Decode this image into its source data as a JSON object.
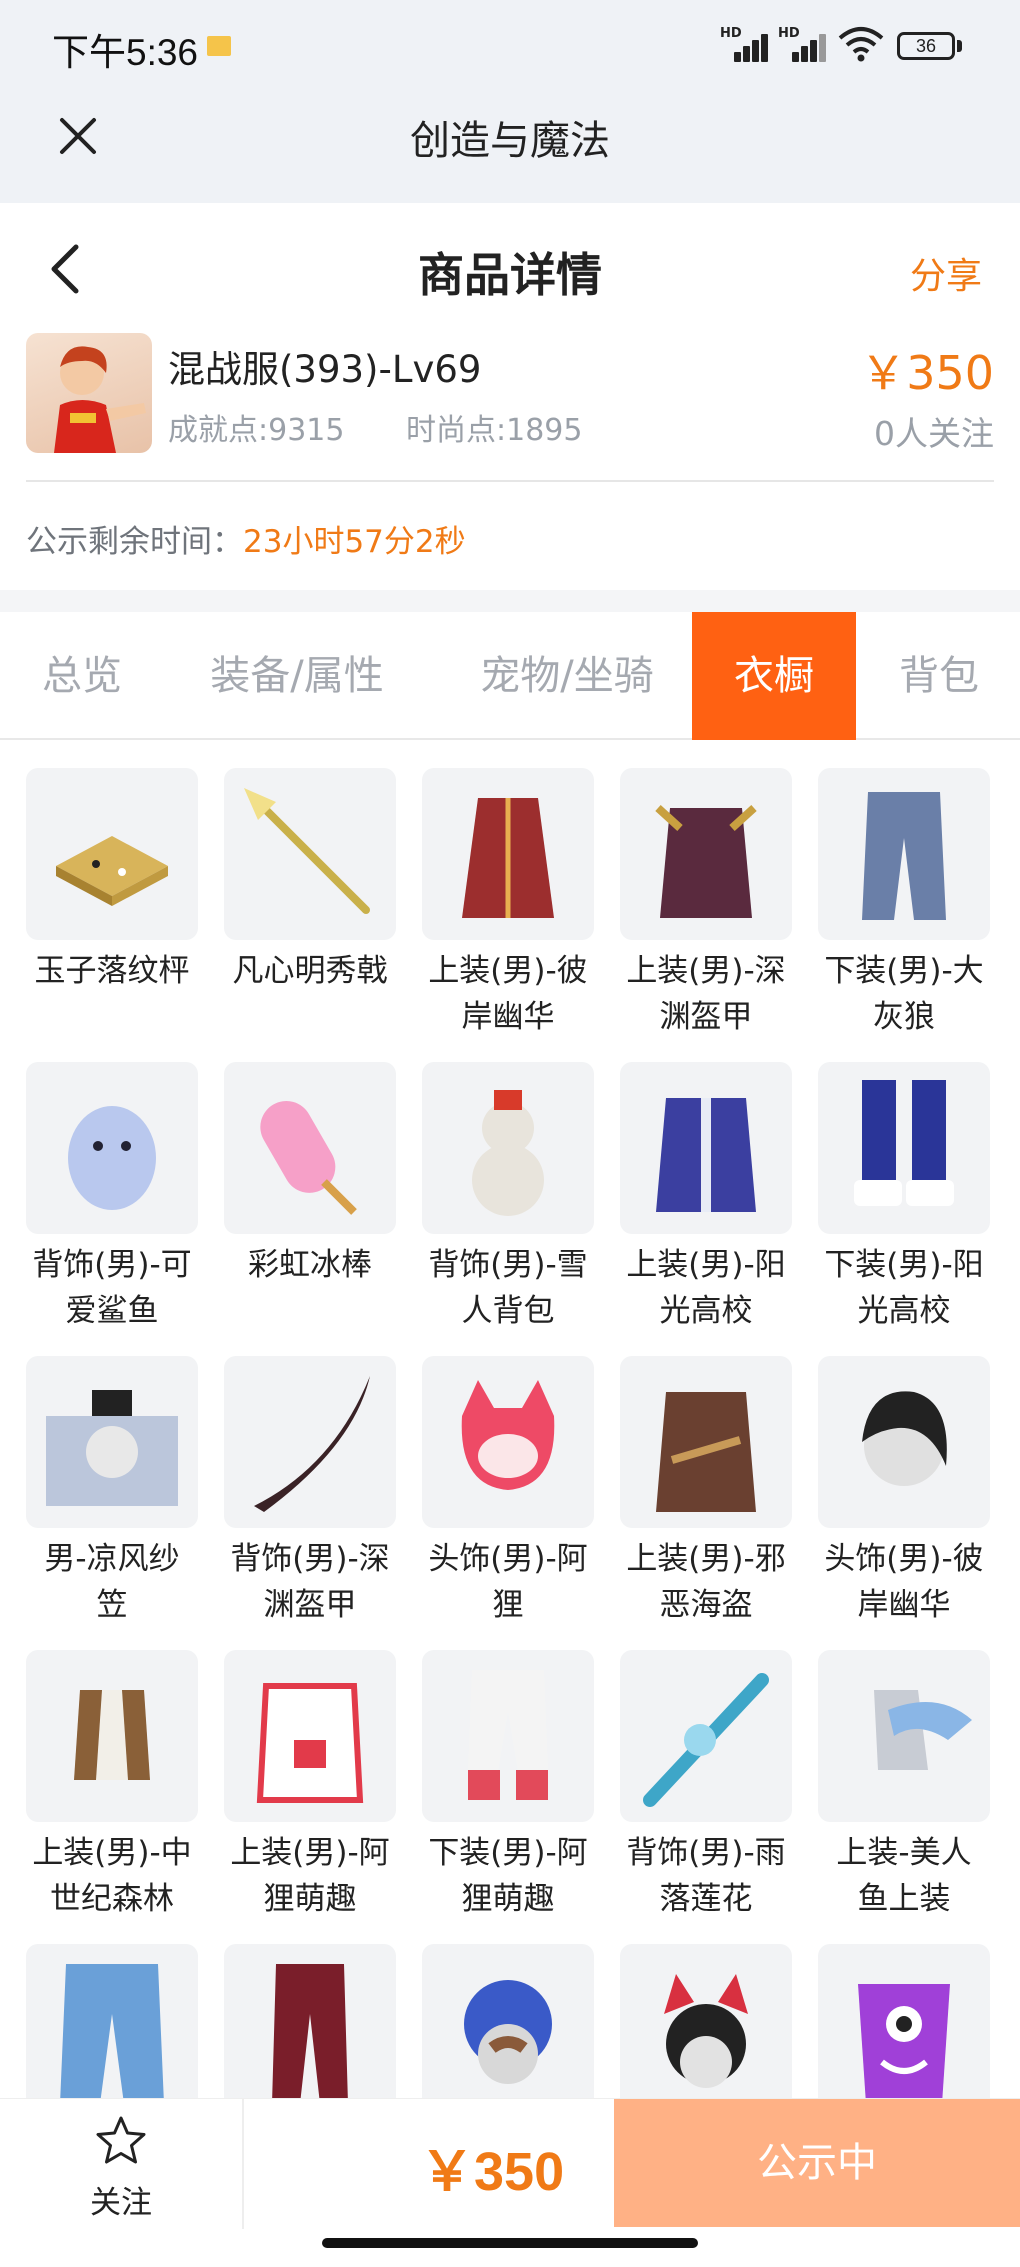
{
  "status_bar": {
    "time": "下午5:36",
    "hd_label": "HD",
    "battery": "36"
  },
  "webview": {
    "title": "创造与魔法"
  },
  "header": {
    "title": "商品详情",
    "share": "分享"
  },
  "product": {
    "name": "混战服(393)-Lv69",
    "achievement": "成就点:9315",
    "fashion": "时尚点:1895",
    "price": "￥350",
    "followers": "0人关注"
  },
  "countdown": {
    "label": "公示剩余时间：",
    "value": "23小时57分2秒"
  },
  "tabs": [
    {
      "label": "总览"
    },
    {
      "label": "装备/属性"
    },
    {
      "label": "宠物/坐骑"
    },
    {
      "label": "衣橱",
      "active": true
    },
    {
      "label": "背包"
    }
  ],
  "wardrobe": [
    {
      "label_1": "玉子落纹枰",
      "label_2": "",
      "icon": "go-board-icon",
      "color": "#d8b45a"
    },
    {
      "label_1": "凡心明秀戟",
      "label_2": "",
      "icon": "halberd-icon",
      "color": "#c9b04a"
    },
    {
      "label_1": "上装(男)-彼",
      "label_2": "岸幽华",
      "icon": "robe-icon",
      "color": "#9c2e2e"
    },
    {
      "label_1": "上装(男)-深",
      "label_2": "渊盔甲",
      "icon": "armor-icon",
      "color": "#5a2a3e"
    },
    {
      "label_1": "下装(男)-大",
      "label_2": "灰狼",
      "icon": "pants-icon",
      "color": "#6a7fa8"
    },
    {
      "label_1": "背饰(男)-可",
      "label_2": "爱鲨鱼",
      "icon": "shark-icon",
      "color": "#b9c8ee"
    },
    {
      "label_1": "彩虹冰棒",
      "label_2": "",
      "icon": "popsicle-icon",
      "color": "#f6a0c8"
    },
    {
      "label_1": "背饰(男)-雪",
      "label_2": "人背包",
      "icon": "snowman-icon",
      "color": "#e8e4dc"
    },
    {
      "label_1": "上装(男)-阳",
      "label_2": "光高校",
      "icon": "jacket-icon",
      "color": "#3b3fa0"
    },
    {
      "label_1": "下装(男)-阳",
      "label_2": "光高校",
      "icon": "boots-icon",
      "color": "#2a3598"
    },
    {
      "label_1": "男-凉风纱",
      "label_2": "笠",
      "icon": "veil-hat-icon",
      "color": "#8ea0c4"
    },
    {
      "label_1": "背饰(男)-深",
      "label_2": "渊盔甲",
      "icon": "blade-icon",
      "color": "#3a2226"
    },
    {
      "label_1": "头饰(男)-阿",
      "label_2": "狸",
      "icon": "fox-head-icon",
      "color": "#ee4a66"
    },
    {
      "label_1": "上装(男)-邪",
      "label_2": "恶海盗",
      "icon": "coat-icon",
      "color": "#6a4030"
    },
    {
      "label_1": "头饰(男)-彼",
      "label_2": "岸幽华",
      "icon": "hair-icon",
      "color": "#222222"
    },
    {
      "label_1": "上装(男)-中",
      "label_2": "世纪森林",
      "icon": "vest-icon",
      "color": "#8a6038"
    },
    {
      "label_1": "上装(男)-阿",
      "label_2": "狸萌趣",
      "icon": "hoodie-icon",
      "color": "#e23a4a"
    },
    {
      "label_1": "下装(男)-阿",
      "label_2": "狸萌趣",
      "icon": "trousers-icon",
      "color": "#e24a5a"
    },
    {
      "label_1": "背饰(男)-雨",
      "label_2": "落莲花",
      "icon": "umbrella-icon",
      "color": "#3ea6c8"
    },
    {
      "label_1": "上装-美人",
      "label_2": "鱼上装",
      "icon": "mermaid-top-icon",
      "color": "#8ab6e6"
    },
    {
      "label_1": "",
      "label_2": "",
      "icon": "leggings-icon",
      "color": "#6aa0d8"
    },
    {
      "label_1": "",
      "label_2": "",
      "icon": "red-pants-icon",
      "color": "#7a1e2a"
    },
    {
      "label_1": "",
      "label_2": "",
      "icon": "octopus-hat-icon",
      "color": "#3a5ac8"
    },
    {
      "label_1": "",
      "label_2": "",
      "icon": "cat-ears-icon",
      "color": "#d83040"
    },
    {
      "label_1": "",
      "label_2": "",
      "icon": "monster-bag-icon",
      "color": "#a040d8"
    }
  ],
  "bottom": {
    "follow": "关注",
    "price": "￥350",
    "action": "公示中"
  },
  "colors": {
    "accent": "#f07a16",
    "tab_active": "#ff6112",
    "button": "#ffb185"
  }
}
